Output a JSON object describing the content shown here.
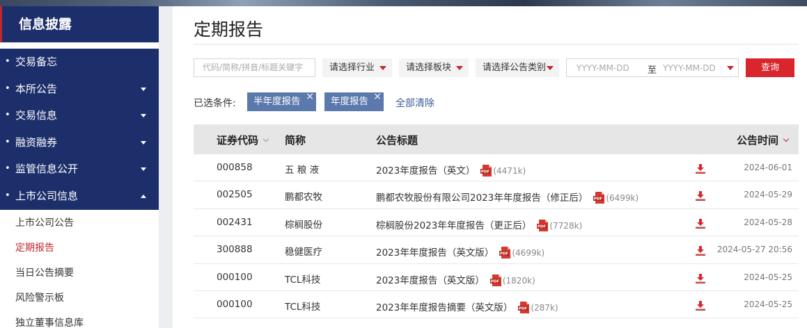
{
  "sidebar": {
    "title": "信息披露",
    "menu": [
      {
        "label": "交易备忘",
        "caret": "none"
      },
      {
        "label": "本所公告",
        "caret": "down"
      },
      {
        "label": "交易信息",
        "caret": "down"
      },
      {
        "label": "融资融券",
        "caret": "down"
      },
      {
        "label": "监管信息公开",
        "caret": "down"
      },
      {
        "label": "上市公司信息",
        "caret": "up"
      }
    ],
    "sub_menu": [
      {
        "label": "上市公司公告",
        "active": false
      },
      {
        "label": "定期报告",
        "active": true
      },
      {
        "label": "当日公告摘要",
        "active": false
      },
      {
        "label": "风险警示板",
        "active": false
      },
      {
        "label": "独立董事信息库",
        "active": false
      }
    ]
  },
  "main": {
    "title": "定期报告",
    "filters": {
      "search_placeholder": "代码/简称/拼音/标题关键字",
      "industry": "请选择行业",
      "board": "请选择板块",
      "category": "请选择公告类别",
      "date_from": "YYYY-MM-DD",
      "date_to_label": "至",
      "date_to": "YYYY-MM-DD",
      "query_button": "查询"
    },
    "selected": {
      "label": "已选条件:",
      "tags": [
        "半年度报告",
        "年度报告"
      ],
      "clear_all": "全部清除"
    },
    "table": {
      "headers": {
        "code": "证券代码",
        "name": "简称",
        "title": "公告标题",
        "time": "公告时间"
      },
      "rows": [
        {
          "code": "000858",
          "name": "五 粮 液",
          "title": "2023年度报告（英文）",
          "size": "(4471k)",
          "time": "2024-06-01"
        },
        {
          "code": "002505",
          "name": "鹏都农牧",
          "title": "鹏都农牧股份有限公司2023年年度报告（修正后）",
          "size": "(6499k)",
          "time": "2024-05-29"
        },
        {
          "code": "002431",
          "name": "棕榈股份",
          "title": "棕榈股份2023年年度报告（更正后）",
          "size": "(7728k)",
          "time": "2024-05-28"
        },
        {
          "code": "300888",
          "name": "稳健医疗",
          "title": "2023年年度报告（英文版）",
          "size": "(4699k)",
          "time": "2024-05-27 20:56"
        },
        {
          "code": "000100",
          "name": "TCL科技",
          "title": "2023年度报告（英文版）",
          "size": "(1820k)",
          "time": "2024-05-25"
        },
        {
          "code": "000100",
          "name": "TCL科技",
          "title": "2023年年度报告摘要（英文版）",
          "size": "(287k)",
          "time": "2024-05-25"
        }
      ]
    }
  },
  "colors": {
    "navy": "#1d2f6b",
    "accent_red": "#d9262c",
    "tag_blue": "#5b79ad"
  }
}
